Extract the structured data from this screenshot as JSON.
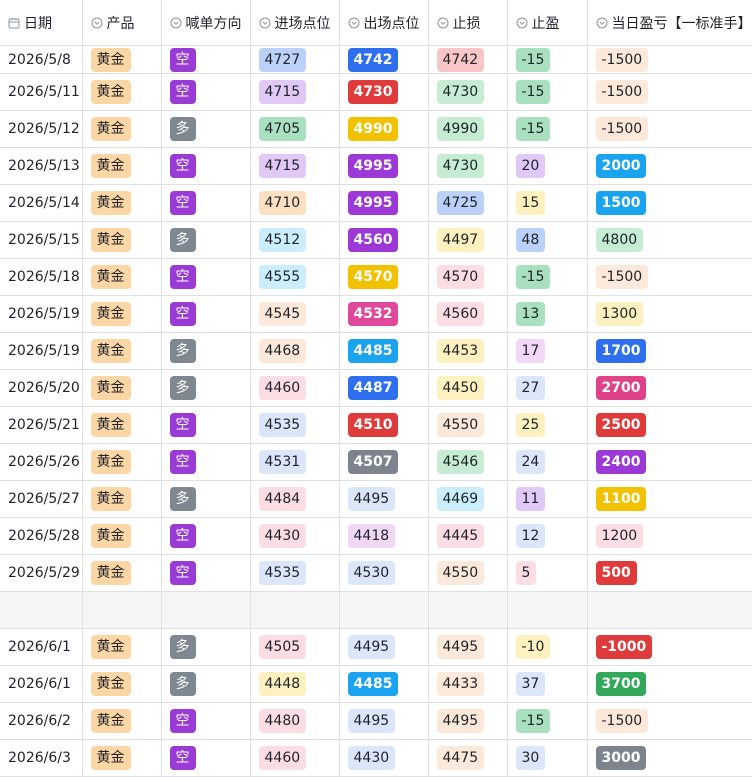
{
  "headers": [
    {
      "label": "日期",
      "icon": "calendar-icon"
    },
    {
      "label": "产品",
      "icon": "dropdown-circle-icon"
    },
    {
      "label": "喊单方向",
      "icon": "dropdown-circle-icon"
    },
    {
      "label": "进场点位",
      "icon": "dropdown-circle-icon"
    },
    {
      "label": "出场点位",
      "icon": "dropdown-circle-icon"
    },
    {
      "label": "止损",
      "icon": "dropdown-circle-icon"
    },
    {
      "label": "止盈",
      "icon": "dropdown-circle-icon"
    },
    {
      "label": "当日盈亏【一标准手】",
      "icon": "dropdown-circle-icon"
    }
  ],
  "colors": {
    "gold": "#fdd6a5",
    "short": "#9b3bd6",
    "long": "#7f8790",
    "lavender": "#e0c8f7",
    "blue_light": "#bcd1fa",
    "pink": "#f8c6c6",
    "green_light": "#c6ecd4",
    "orange_light": "#fde0c2",
    "yellow_light": "#fdf1bf",
    "cyan_light": "#caeefc",
    "peach": "#fde9d9",
    "blue_pale": "#dbe6fb",
    "pink_pale": "#fcdde3",
    "purple_pale": "#f1d8f7",
    "green_mid": "#a9e0bf",
    "blue": "#2e6ff0",
    "red": "#e03b3b",
    "yellow": "#f2c200",
    "purple": "#9c38d6",
    "magenta": "#e0489c",
    "cyan": "#1aa3ef",
    "gray": "#7d848e",
    "green": "#34a85a",
    "rose": "#e0428a"
  },
  "rows": [
    {
      "date": "2026/5/8",
      "product": "黄金",
      "dir": "空",
      "entry": {
        "v": "4727",
        "c": "blue_light",
        "d": false
      },
      "exit": {
        "v": "4742",
        "c": "blue",
        "d": true
      },
      "sl": {
        "v": "4742",
        "c": "pink",
        "d": false
      },
      "tp": {
        "v": "-15",
        "c": "green_mid",
        "d": false
      },
      "pnl": {
        "v": "-1500",
        "c": "peach",
        "d": false
      }
    },
    {
      "date": "2026/5/11",
      "product": "黄金",
      "dir": "空",
      "entry": {
        "v": "4715",
        "c": "lavender",
        "d": false
      },
      "exit": {
        "v": "4730",
        "c": "red",
        "d": true
      },
      "sl": {
        "v": "4730",
        "c": "green_light",
        "d": false
      },
      "tp": {
        "v": "-15",
        "c": "green_mid",
        "d": false
      },
      "pnl": {
        "v": "-1500",
        "c": "peach",
        "d": false
      }
    },
    {
      "date": "2026/5/12",
      "product": "黄金",
      "dir": "多",
      "entry": {
        "v": "4705",
        "c": "green_mid",
        "d": false
      },
      "exit": {
        "v": "4990",
        "c": "yellow",
        "d": true
      },
      "sl": {
        "v": "4990",
        "c": "green_light",
        "d": false
      },
      "tp": {
        "v": "-15",
        "c": "green_mid",
        "d": false
      },
      "pnl": {
        "v": "-1500",
        "c": "peach",
        "d": false
      }
    },
    {
      "date": "2026/5/13",
      "product": "黄金",
      "dir": "空",
      "entry": {
        "v": "4715",
        "c": "lavender",
        "d": false
      },
      "exit": {
        "v": "4995",
        "c": "purple",
        "d": true
      },
      "sl": {
        "v": "4730",
        "c": "green_light",
        "d": false
      },
      "tp": {
        "v": "20",
        "c": "lavender",
        "d": false
      },
      "pnl": {
        "v": "2000",
        "c": "cyan",
        "d": true
      }
    },
    {
      "date": "2026/5/14",
      "product": "黄金",
      "dir": "空",
      "entry": {
        "v": "4710",
        "c": "orange_light",
        "d": false
      },
      "exit": {
        "v": "4995",
        "c": "purple",
        "d": true
      },
      "sl": {
        "v": "4725",
        "c": "blue_light",
        "d": false
      },
      "tp": {
        "v": "15",
        "c": "yellow_light",
        "d": false
      },
      "pnl": {
        "v": "1500",
        "c": "cyan",
        "d": true
      }
    },
    {
      "date": "2026/5/15",
      "product": "黄金",
      "dir": "多",
      "entry": {
        "v": "4512",
        "c": "cyan_light",
        "d": false
      },
      "exit": {
        "v": "4560",
        "c": "purple",
        "d": true
      },
      "sl": {
        "v": "4497",
        "c": "yellow_light",
        "d": false
      },
      "tp": {
        "v": "48",
        "c": "blue_light",
        "d": false
      },
      "pnl": {
        "v": "4800",
        "c": "green_light",
        "d": false
      }
    },
    {
      "date": "2026/5/18",
      "product": "黄金",
      "dir": "空",
      "entry": {
        "v": "4555",
        "c": "cyan_light",
        "d": false
      },
      "exit": {
        "v": "4570",
        "c": "yellow",
        "d": true
      },
      "sl": {
        "v": "4570",
        "c": "pink_pale",
        "d": false
      },
      "tp": {
        "v": "-15",
        "c": "green_mid",
        "d": false
      },
      "pnl": {
        "v": "-1500",
        "c": "peach",
        "d": false
      }
    },
    {
      "date": "2026/5/19",
      "product": "黄金",
      "dir": "空",
      "entry": {
        "v": "4545",
        "c": "peach",
        "d": false
      },
      "exit": {
        "v": "4532",
        "c": "magenta",
        "d": true
      },
      "sl": {
        "v": "4560",
        "c": "pink_pale",
        "d": false
      },
      "tp": {
        "v": "13",
        "c": "green_mid",
        "d": false
      },
      "pnl": {
        "v": "1300",
        "c": "yellow_light",
        "d": false
      }
    },
    {
      "date": "2026/5/19",
      "product": "黄金",
      "dir": "多",
      "entry": {
        "v": "4468",
        "c": "peach",
        "d": false
      },
      "exit": {
        "v": "4485",
        "c": "cyan",
        "d": true
      },
      "sl": {
        "v": "4453",
        "c": "yellow_light",
        "d": false
      },
      "tp": {
        "v": "17",
        "c": "purple_pale",
        "d": false
      },
      "pnl": {
        "v": "1700",
        "c": "blue",
        "d": true
      }
    },
    {
      "date": "2026/5/20",
      "product": "黄金",
      "dir": "多",
      "entry": {
        "v": "4460",
        "c": "pink_pale",
        "d": false
      },
      "exit": {
        "v": "4487",
        "c": "blue",
        "d": true
      },
      "sl": {
        "v": "4450",
        "c": "yellow_light",
        "d": false
      },
      "tp": {
        "v": "27",
        "c": "blue_pale",
        "d": false
      },
      "pnl": {
        "v": "2700",
        "c": "rose",
        "d": true
      }
    },
    {
      "date": "2026/5/21",
      "product": "黄金",
      "dir": "空",
      "entry": {
        "v": "4535",
        "c": "blue_pale",
        "d": false
      },
      "exit": {
        "v": "4510",
        "c": "red",
        "d": true
      },
      "sl": {
        "v": "4550",
        "c": "peach",
        "d": false
      },
      "tp": {
        "v": "25",
        "c": "yellow_light",
        "d": false
      },
      "pnl": {
        "v": "2500",
        "c": "red",
        "d": true
      }
    },
    {
      "date": "2026/5/26",
      "product": "黄金",
      "dir": "空",
      "entry": {
        "v": "4531",
        "c": "blue_pale",
        "d": false
      },
      "exit": {
        "v": "4507",
        "c": "gray",
        "d": true
      },
      "sl": {
        "v": "4546",
        "c": "green_light",
        "d": false
      },
      "tp": {
        "v": "24",
        "c": "blue_pale",
        "d": false
      },
      "pnl": {
        "v": "2400",
        "c": "purple",
        "d": true
      }
    },
    {
      "date": "2026/5/27",
      "product": "黄金",
      "dir": "多",
      "entry": {
        "v": "4484",
        "c": "pink_pale",
        "d": false
      },
      "exit": {
        "v": "4495",
        "c": "blue_pale",
        "d": false
      },
      "sl": {
        "v": "4469",
        "c": "cyan_light",
        "d": false
      },
      "tp": {
        "v": "11",
        "c": "lavender",
        "d": false
      },
      "pnl": {
        "v": "1100",
        "c": "yellow",
        "d": true
      }
    },
    {
      "date": "2026/5/28",
      "product": "黄金",
      "dir": "空",
      "entry": {
        "v": "4430",
        "c": "pink_pale",
        "d": false
      },
      "exit": {
        "v": "4418",
        "c": "purple_pale",
        "d": false
      },
      "sl": {
        "v": "4445",
        "c": "pink_pale",
        "d": false
      },
      "tp": {
        "v": "12",
        "c": "blue_pale",
        "d": false
      },
      "pnl": {
        "v": "1200",
        "c": "pink_pale",
        "d": false
      }
    },
    {
      "date": "2026/5/29",
      "product": "黄金",
      "dir": "空",
      "entry": {
        "v": "4535",
        "c": "blue_pale",
        "d": false
      },
      "exit": {
        "v": "4530",
        "c": "blue_pale",
        "d": false
      },
      "sl": {
        "v": "4550",
        "c": "peach",
        "d": false
      },
      "tp": {
        "v": "5",
        "c": "pink_pale",
        "d": false
      },
      "pnl": {
        "v": "500",
        "c": "red",
        "d": true
      }
    },
    {
      "gap": true
    },
    {
      "date": "2026/6/1",
      "product": "黄金",
      "dir": "多",
      "entry": {
        "v": "4505",
        "c": "pink_pale",
        "d": false
      },
      "exit": {
        "v": "4495",
        "c": "blue_pale",
        "d": false
      },
      "sl": {
        "v": "4495",
        "c": "peach",
        "d": false
      },
      "tp": {
        "v": "-10",
        "c": "yellow_light",
        "d": false
      },
      "pnl": {
        "v": "-1000",
        "c": "red",
        "d": true
      }
    },
    {
      "date": "2026/6/1",
      "product": "黄金",
      "dir": "多",
      "entry": {
        "v": "4448",
        "c": "yellow_light",
        "d": false
      },
      "exit": {
        "v": "4485",
        "c": "cyan",
        "d": true
      },
      "sl": {
        "v": "4433",
        "c": "peach",
        "d": false
      },
      "tp": {
        "v": "37",
        "c": "blue_pale",
        "d": false
      },
      "pnl": {
        "v": "3700",
        "c": "green",
        "d": true
      }
    },
    {
      "date": "2026/6/2",
      "product": "黄金",
      "dir": "空",
      "entry": {
        "v": "4480",
        "c": "pink_pale",
        "d": false
      },
      "exit": {
        "v": "4495",
        "c": "blue_pale",
        "d": false
      },
      "sl": {
        "v": "4495",
        "c": "peach",
        "d": false
      },
      "tp": {
        "v": "-15",
        "c": "green_mid",
        "d": false
      },
      "pnl": {
        "v": "-1500",
        "c": "peach",
        "d": false
      }
    },
    {
      "date": "2026/6/3",
      "product": "黄金",
      "dir": "空",
      "entry": {
        "v": "4460",
        "c": "pink_pale",
        "d": false
      },
      "exit": {
        "v": "4430",
        "c": "blue_pale",
        "d": false
      },
      "sl": {
        "v": "4475",
        "c": "peach",
        "d": false
      },
      "tp": {
        "v": "30",
        "c": "blue_pale",
        "d": false
      },
      "pnl": {
        "v": "3000",
        "c": "gray",
        "d": true
      }
    }
  ]
}
